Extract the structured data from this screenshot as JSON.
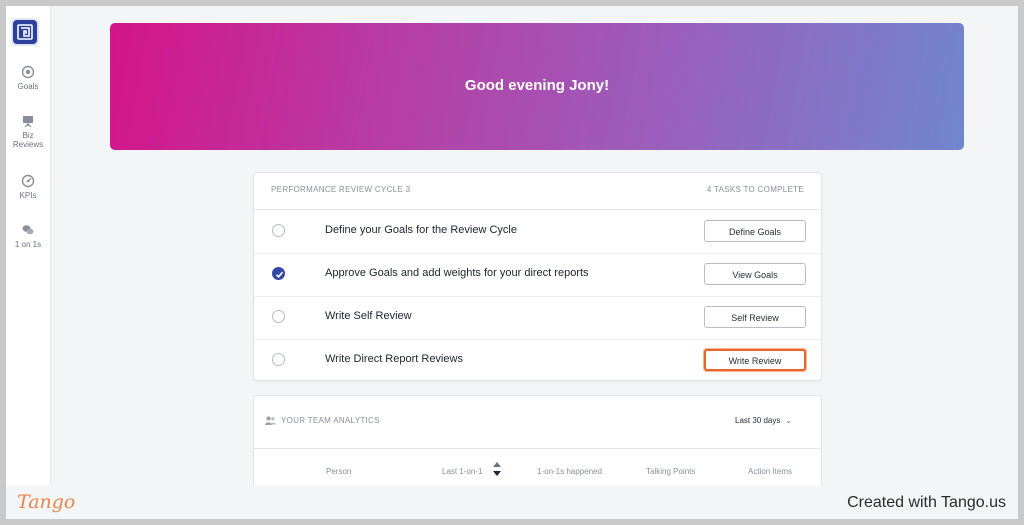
{
  "sidebar": {
    "items": [
      {
        "label": "Goals",
        "icon": "target-icon"
      },
      {
        "label": "Biz\nReviews",
        "icon": "presentation-icon"
      },
      {
        "label": "KPIs",
        "icon": "gauge-icon"
      },
      {
        "label": "1 on 1s",
        "icon": "chat-bubbles-icon"
      }
    ]
  },
  "banner": {
    "greeting": "Good evening Jony!"
  },
  "review_cycle": {
    "title": "PERFORMANCE REVIEW CYCLE 3",
    "tasks_count": "4 TASKS TO COMPLETE",
    "tasks": [
      {
        "label": "Define your Goals for the Review Cycle",
        "button": "Define Goals",
        "done": false
      },
      {
        "label": "Approve Goals and add weights for your direct reports",
        "button": "View Goals",
        "done": true
      },
      {
        "label": "Write Self Review",
        "button": "Self Review",
        "done": false
      },
      {
        "label": "Write Direct Report Reviews",
        "button": "Write Review",
        "done": false
      }
    ]
  },
  "team_analytics": {
    "title": "YOUR TEAM ANALYTICS",
    "range": "Last 30 days",
    "columns": [
      "Person",
      "Last 1-on-1",
      "1-on-1s happened",
      "Talking Points",
      "Action Items"
    ]
  },
  "footer": {
    "brand": "Tango",
    "created_with": "Created with Tango.us"
  },
  "colors": {
    "accent": "#3447a6",
    "highlight": "#e8662a",
    "banner_start": "#d4148a",
    "banner_end": "#7086cf"
  }
}
